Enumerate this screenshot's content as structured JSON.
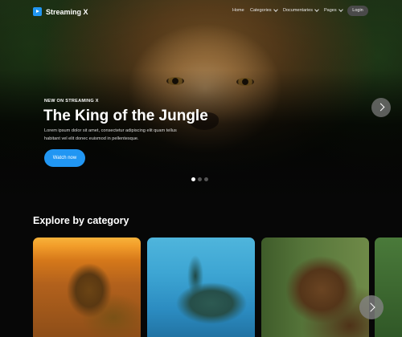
{
  "nav": {
    "brand": "Streaming X",
    "items": [
      {
        "label": "Home",
        "dropdown": false
      },
      {
        "label": "Categories",
        "dropdown": true
      },
      {
        "label": "Documentaries",
        "dropdown": true
      },
      {
        "label": "Pages",
        "dropdown": true
      }
    ],
    "login_label": "Login"
  },
  "hero": {
    "eyebrow": "NEW ON STREAMING X",
    "title": "The King of the Jungle",
    "description": "Lorem ipsum dolor sit amet, consectetur adipiscing elit quam tellus habitant vel elit donec euismod in pellentesque.",
    "cta_label": "Watch now",
    "slides": 3,
    "active_slide": 1
  },
  "categories": {
    "title": "Explore by category",
    "cards": [
      {
        "subject": "lion"
      },
      {
        "subject": "sea turtle"
      },
      {
        "subject": "bear"
      },
      {
        "subject": "forest"
      }
    ]
  },
  "colors": {
    "accent": "#2196f3",
    "background": "#070707"
  }
}
